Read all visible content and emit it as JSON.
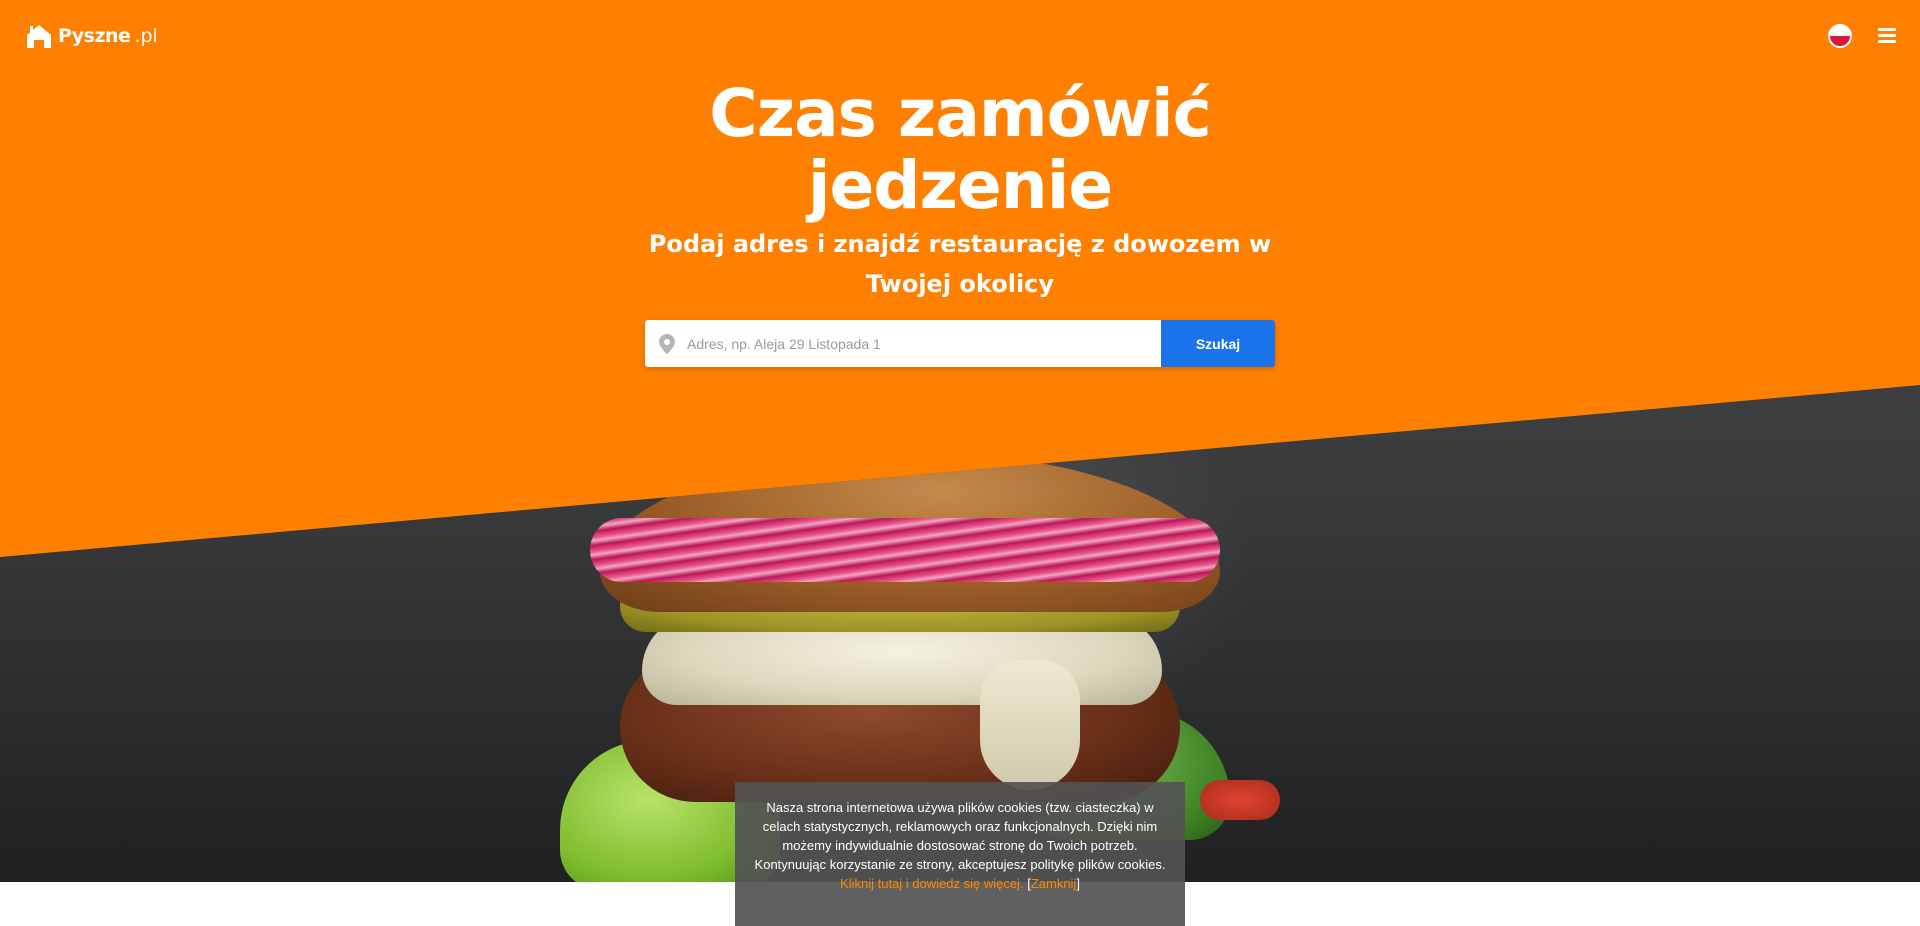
{
  "header": {
    "logo_text": "Pyszne",
    "logo_suffix": ".pl",
    "logo_icon": "house-logo-icon",
    "language_icon": "poland-flag-icon",
    "menu_icon": "hamburger-menu-icon"
  },
  "hero": {
    "title_line1": "Czas zamówić",
    "title_line2": "jedzenie",
    "subtitle_line1": "Podaj adres i znajdź restaurację z dowozem w",
    "subtitle_line2": "Twojej okolicy"
  },
  "search": {
    "placeholder": "Adres, np. Aleja 29 Listopada 1",
    "value": "",
    "button_label": "Szukaj",
    "pin_icon": "location-pin-icon"
  },
  "cookie_banner": {
    "message": "Nasza strona internetowa używa plików cookies (tzw. ciasteczka) w celach statystycznych, reklamowych oraz funkcjonalnych. Dzięki nim możemy indywidualnie dostosować stronę do Twoich potrzeb. Kontynuując korzystanie ze strony, akceptujesz politykę plików cookies.",
    "learn_more_link": "Kliknij tutaj i dowiedz się więcej.",
    "bracket_open": "[",
    "close_link": "Zamknij",
    "bracket_close": "]"
  },
  "colors": {
    "brand_orange": "#ff8000",
    "button_blue": "#1a73e8",
    "link_orange": "#ff8a00"
  }
}
